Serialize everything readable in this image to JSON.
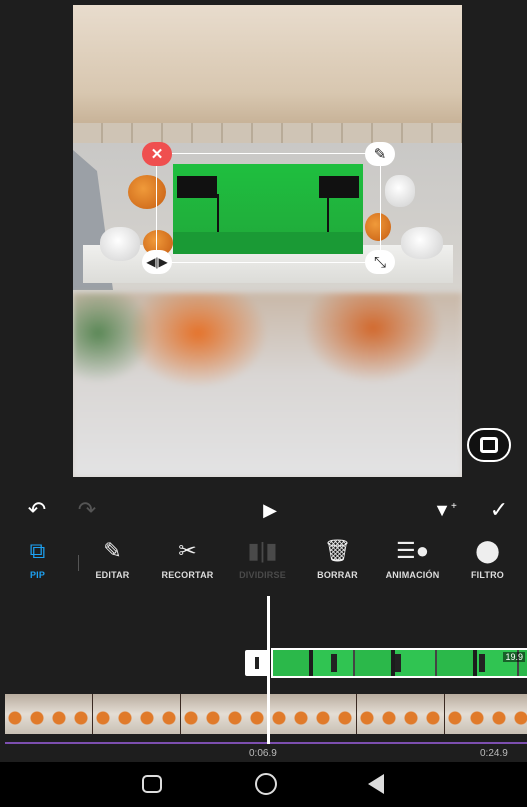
{
  "toolbar": {
    "items": [
      {
        "label": "PIP",
        "icon": "pip-icon",
        "active": true
      },
      {
        "label": "EDITAR",
        "icon": "pencil-icon"
      },
      {
        "label": "RECORTAR",
        "icon": "scissors-icon"
      },
      {
        "label": "DIVIDIRSE",
        "icon": "split-icon",
        "disabled": true
      },
      {
        "label": "BORRAR",
        "icon": "trash-icon"
      },
      {
        "label": "ANIMACIÓN",
        "icon": "animation-icon"
      },
      {
        "label": "FILTRO",
        "icon": "filter-icon"
      }
    ],
    "active_color": "#1da1f2"
  },
  "timeline": {
    "current_time": "0:06.9",
    "total_time": "0:24.9",
    "pip_clip_duration": "19.9"
  },
  "controls": {
    "undo_icon": "undo-icon",
    "redo_icon": "redo-icon",
    "play_icon": "play-icon",
    "keyframe_icon": "keyframe-add-icon",
    "confirm_icon": "check-icon"
  },
  "pip_handles": {
    "close_icon": "close-icon",
    "edit_icon": "pencil-icon",
    "flip_icon": "flip-icon",
    "scale_icon": "resize-icon",
    "close_color": "#ef4f4f"
  },
  "preview_ctrl": {
    "fit_icon": "aspect-fit-icon"
  },
  "navbar": {
    "recent_icon": "recents-icon",
    "home_icon": "home-icon",
    "back_icon": "back-icon"
  },
  "colors": {
    "background": "#1e1e1e",
    "track_line": "#7d4fb0",
    "green_screen": "#1fbf3f"
  }
}
